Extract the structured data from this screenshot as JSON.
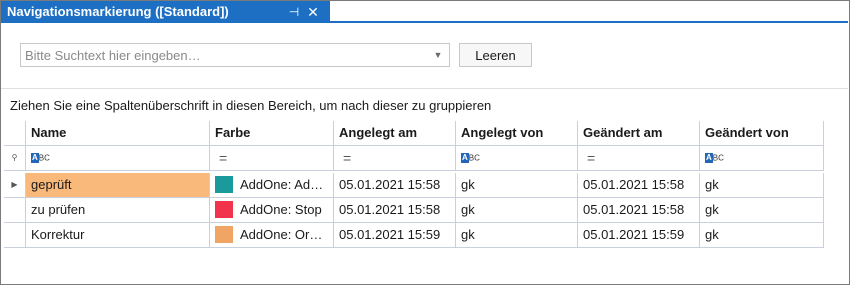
{
  "tab": {
    "title": "Navigationsmarkierung ([Standard])",
    "pin_glyph": "⊣",
    "close_glyph": "✕"
  },
  "search": {
    "placeholder": "Bitte Suchtext hier eingeben…",
    "value": "",
    "dropdown_glyph": "▼",
    "clear_label": "Leeren"
  },
  "group_panel": {
    "text": "Ziehen Sie eine Spaltenüberschrift in diesen Bereich, um nach dieser zu gruppieren"
  },
  "grid": {
    "columns": [
      "Name",
      "Farbe",
      "Angelegt am",
      "Angelegt von",
      "Geändert am",
      "Geändert von"
    ],
    "filter_row": {
      "indicator_glyph": "⚲",
      "abc_prefix": "A",
      "abc_suffix": "BC",
      "eq_glyph": "="
    },
    "row_indicator_glyph": "▶",
    "rows": [
      {
        "name": "geprüft",
        "color_label": "AddOne: Ad…",
        "color": "#1a9a9a",
        "created_at": "05.01.2021 15:58",
        "created_by": "gk",
        "modified_at": "05.01.2021 15:58",
        "modified_by": "gk"
      },
      {
        "name": "zu prüfen",
        "color_label": "AddOne: Stop",
        "color": "#f2334c",
        "created_at": "05.01.2021 15:58",
        "created_by": "gk",
        "modified_at": "05.01.2021 15:58",
        "modified_by": "gk"
      },
      {
        "name": "Korrektur",
        "color_label": "AddOne: Or…",
        "color": "#f0a565",
        "created_at": "05.01.2021 15:59",
        "created_by": "gk",
        "modified_at": "05.01.2021 15:59",
        "modified_by": "gk"
      }
    ]
  },
  "colors": {
    "accent": "#1c6fc2",
    "selected_name_bg": "#f9b97a"
  }
}
